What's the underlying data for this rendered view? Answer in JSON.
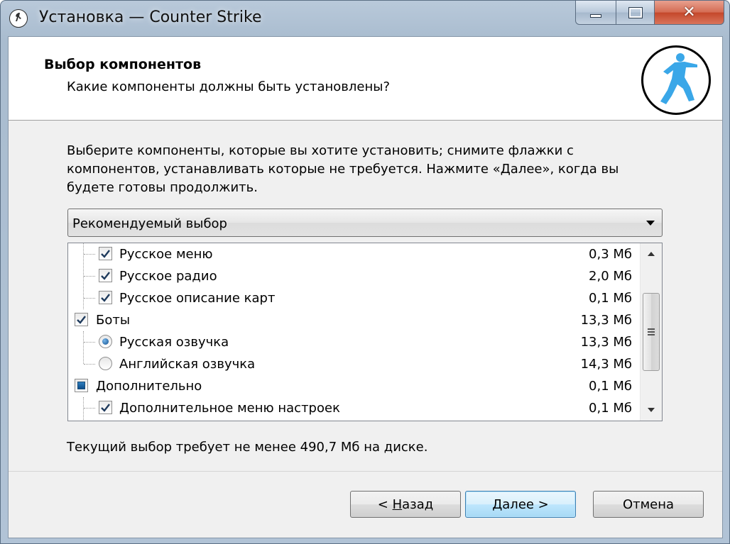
{
  "window": {
    "title": "Установка — Counter Strike"
  },
  "header": {
    "title": "Выбор компонентов",
    "subtitle": "Какие компоненты должны быть установлены?",
    "logo_icon": "counter-strike-logo-icon"
  },
  "description": "Выберите компоненты, которые вы хотите установить; снимите флажки с компонентов, устанавливать которые не требуется. Нажмите «Далее», когда вы будете готовы продолжить.",
  "preset": {
    "selected": "Рекомендуемый выбор"
  },
  "components": [
    {
      "label": "Русское меню",
      "size": "0,3 Мб",
      "control": "checkbox",
      "state": "checked",
      "level": 1
    },
    {
      "label": "Русское радио",
      "size": "2,0 Мб",
      "control": "checkbox",
      "state": "checked",
      "level": 1
    },
    {
      "label": "Русское описание карт",
      "size": "0,1 Мб",
      "control": "checkbox",
      "state": "checked",
      "level": 1
    },
    {
      "label": "Боты",
      "size": "13,3 Мб",
      "control": "checkbox",
      "state": "checked",
      "level": 0
    },
    {
      "label": "Русская озвучка",
      "size": "13,3 Мб",
      "control": "radio",
      "state": "selected",
      "level": 1
    },
    {
      "label": "Английская озвучка",
      "size": "14,3 Мб",
      "control": "radio",
      "state": "unselected",
      "level": 1
    },
    {
      "label": "Дополнительно",
      "size": "0,1 Мб",
      "control": "checkbox",
      "state": "partial",
      "level": 0
    },
    {
      "label": "Дополнительное меню настроек",
      "size": "0,1 Мб",
      "control": "checkbox",
      "state": "checked",
      "level": 1
    }
  ],
  "space_required": "Текущий выбор требует не менее 490,7 Мб на диске.",
  "buttons": {
    "back_prefix": "< ",
    "back_accel": "Н",
    "back_rest": "азад",
    "next": "Далее >",
    "cancel": "Отмена"
  },
  "colors": {
    "accent_checkbox": "#0d4d8a",
    "default_button_border": "#3c7fb1",
    "close_button": "#c4472a"
  }
}
